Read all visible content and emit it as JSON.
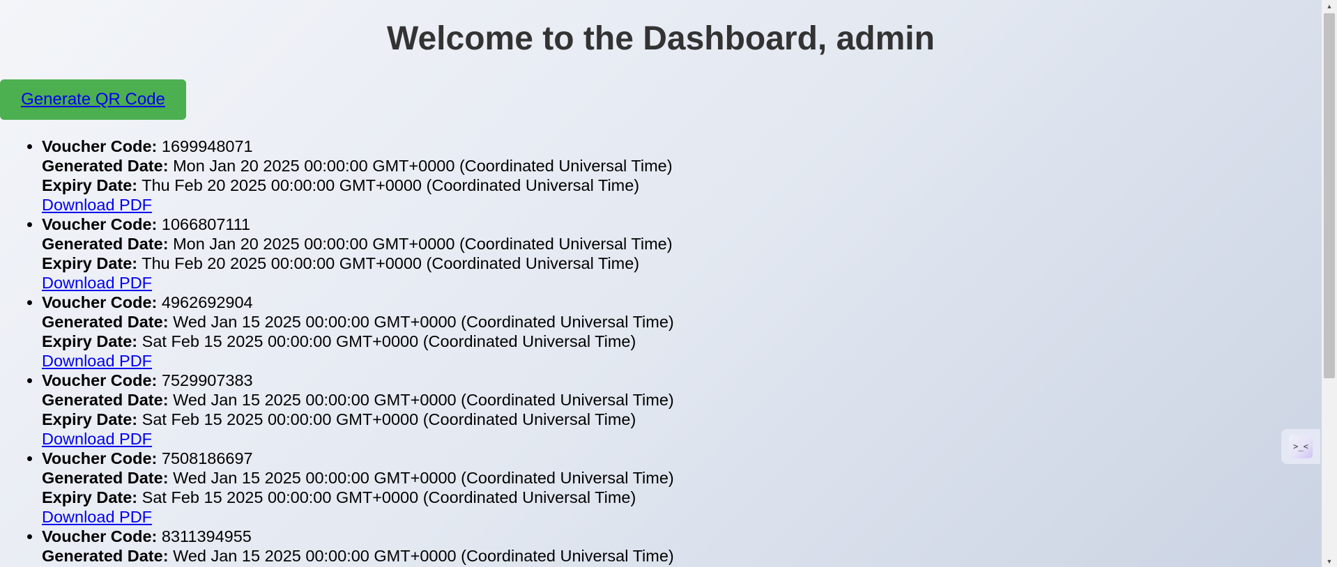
{
  "header": {
    "title": "Welcome to the Dashboard, admin"
  },
  "actions": {
    "generate_label": "Generate QR Code"
  },
  "labels": {
    "voucher_code": "Voucher Code:",
    "generated_date": "Generated Date:",
    "expiry_date": "Expiry Date:",
    "download": "Download PDF"
  },
  "vouchers": [
    {
      "code": "1699948071",
      "generated": "Mon Jan 20 2025 00:00:00 GMT+0000 (Coordinated Universal Time)",
      "expiry": "Thu Feb 20 2025 00:00:00 GMT+0000 (Coordinated Universal Time)"
    },
    {
      "code": "1066807111",
      "generated": "Mon Jan 20 2025 00:00:00 GMT+0000 (Coordinated Universal Time)",
      "expiry": "Thu Feb 20 2025 00:00:00 GMT+0000 (Coordinated Universal Time)"
    },
    {
      "code": "4962692904",
      "generated": "Wed Jan 15 2025 00:00:00 GMT+0000 (Coordinated Universal Time)",
      "expiry": "Sat Feb 15 2025 00:00:00 GMT+0000 (Coordinated Universal Time)"
    },
    {
      "code": "7529907383",
      "generated": "Wed Jan 15 2025 00:00:00 GMT+0000 (Coordinated Universal Time)",
      "expiry": "Sat Feb 15 2025 00:00:00 GMT+0000 (Coordinated Universal Time)"
    },
    {
      "code": "7508186697",
      "generated": "Wed Jan 15 2025 00:00:00 GMT+0000 (Coordinated Universal Time)",
      "expiry": "Sat Feb 15 2025 00:00:00 GMT+0000 (Coordinated Universal Time)"
    },
    {
      "code": "8311394955",
      "generated": "Wed Jan 15 2025 00:00:00 GMT+0000 (Coordinated Universal Time)",
      "expiry": ""
    }
  ],
  "widget": {
    "glyph": ">_<",
    "icon": "assistant-widget-icon"
  },
  "colors": {
    "button": "#4caf50",
    "link": "#0000ee",
    "title": "#333333"
  }
}
